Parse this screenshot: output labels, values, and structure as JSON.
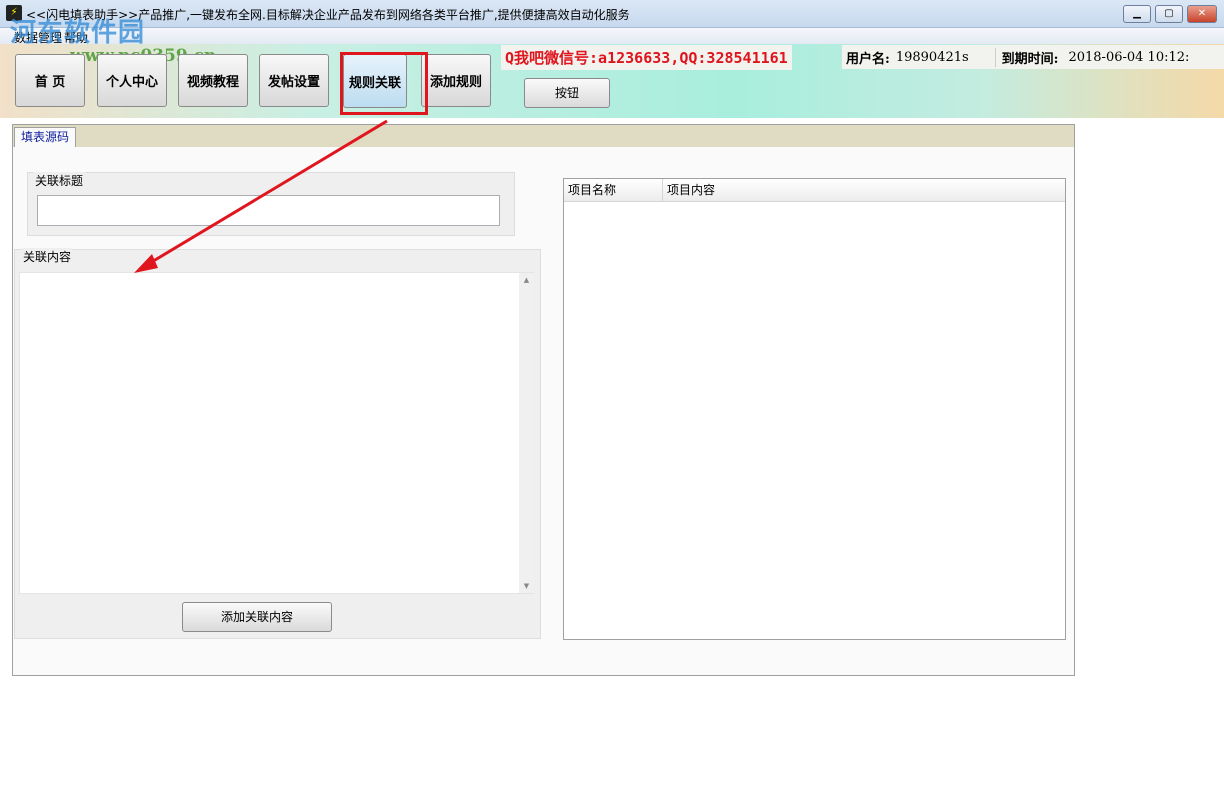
{
  "window": {
    "title": "<<闪电填表助手>>产品推广,一键发布全网.目标解决企业产品发布到网络各类平台推广,提供便捷高效自动化服务",
    "app_icon": "lightning-icon",
    "minimize": "minimize-icon",
    "maximize": "maximize-icon",
    "close": "close-icon"
  },
  "menu": [
    "数据管理",
    "帮助"
  ],
  "watermark": {
    "name": "河东软件园",
    "url": "www.pc0359.cn"
  },
  "nav": [
    "首 页",
    "个人中心",
    "视频教程",
    "发帖设置",
    "规则关联",
    "添加规则"
  ],
  "active_nav": "规则关联",
  "button_label": "按钮",
  "contact": "Q我吧微信号:a1236633,QQ:328541161",
  "user": {
    "label": "用户名:",
    "value": "19890421s",
    "expire_label": "到期时间:",
    "expire_value": "2018-06-04 10:12:"
  },
  "tab": "填表源码",
  "form": {
    "title_label": "关联标题",
    "title_value": "",
    "content_label": "关联内容",
    "content_value": "",
    "add_button": "添加关联内容"
  },
  "list": {
    "columns": [
      "项目名称",
      "项目内容"
    ],
    "rows": []
  },
  "colors": {
    "highlight": "#e0161e",
    "contact": "#e0141c"
  }
}
